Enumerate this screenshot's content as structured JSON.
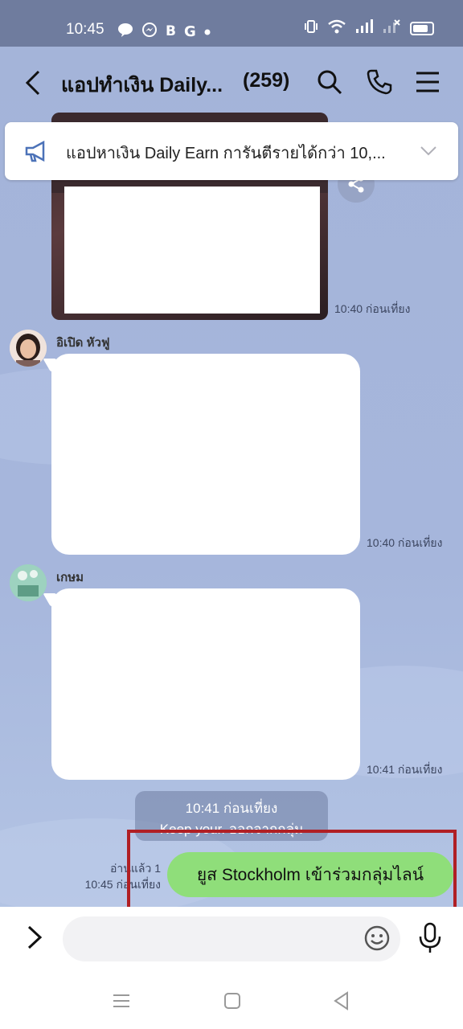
{
  "status_bar": {
    "time": "10:45",
    "icons": [
      "line-icon",
      "messenger-icon",
      "b-icon",
      "g-icon",
      "dot-icon"
    ],
    "right_icons": [
      "vibrate-icon",
      "wifi-icon",
      "signal-icon",
      "signal-off-icon",
      "battery-icon"
    ]
  },
  "header": {
    "title": "แอปทำเงิน Daily...",
    "member_count": "(259)"
  },
  "announcement": {
    "text": "แอปหาเงิน Daily Earn การันตีรายได้กว่า 10,..."
  },
  "messages": [
    {
      "type": "image",
      "time": "10:40 ก่อนเที่ยง"
    },
    {
      "type": "text",
      "sender": "อิเปิด หัวฟู",
      "time": "10:40 ก่อนเที่ยง"
    },
    {
      "type": "text",
      "sender": "เกษม",
      "time": "10:41 ก่อนเที่ยง"
    }
  ],
  "system_message": {
    "line1": "10:41 ก่อนเที่ยง",
    "line2": "Keep your. ออกจากกลุ่ม"
  },
  "sent_message": {
    "read_status": "อ่านแล้ว 1",
    "time": "10:45 ก่อนเที่ยง",
    "text": "ยูส Stockholm เข้าร่วมกลุ่มไลน์"
  },
  "input": {
    "placeholder": ""
  },
  "colors": {
    "chat_background": "#a4b4d9",
    "sent_bubble": "#8fde7a",
    "highlight": "#b01f24"
  }
}
